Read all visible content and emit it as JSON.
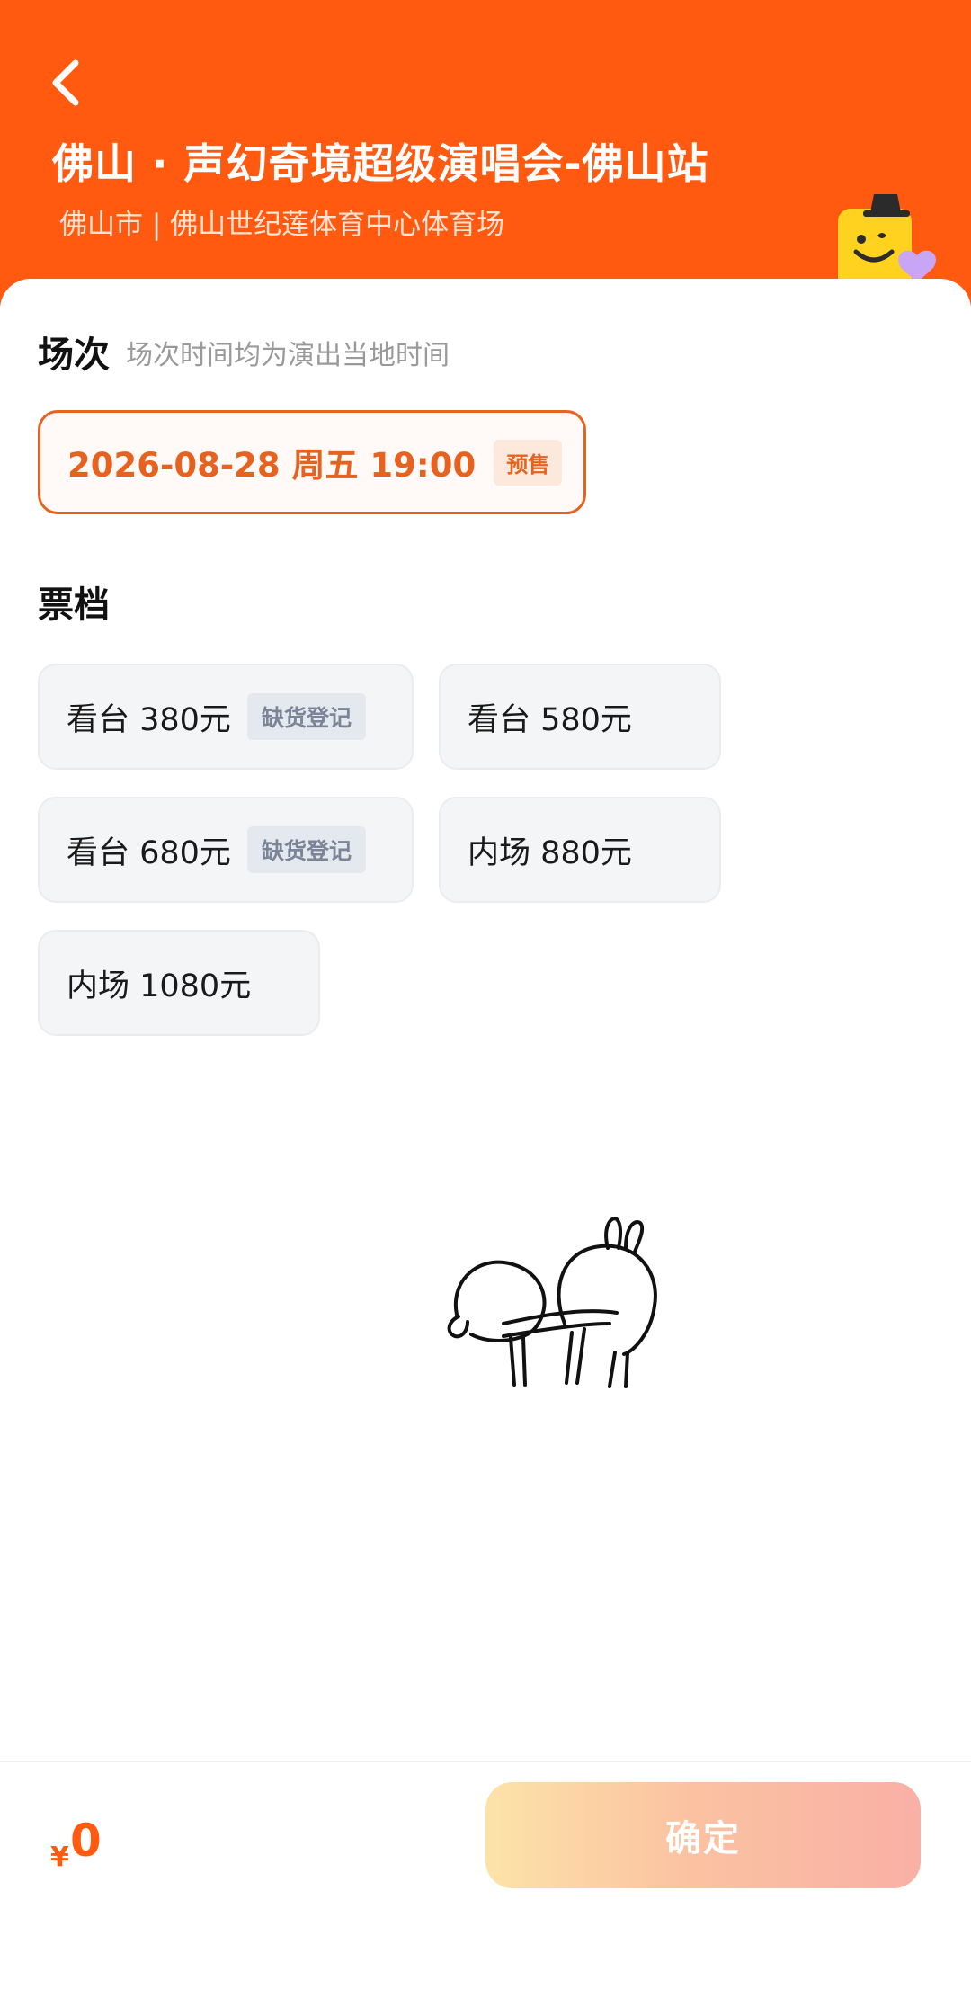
{
  "header": {
    "back_icon": "chevron-left-icon",
    "title": "佛山 · 声幻奇境超级演唱会-佛山站",
    "venue": "佛山市 | 佛山世纪莲体育中心体育场",
    "mascot_icon": "smiley-mascot-icon"
  },
  "session": {
    "title": "场次",
    "hint": "场次时间均为演出当地时间",
    "option": {
      "datetime": "2026-08-28  周五 19:00",
      "tag": "预售",
      "selected": true
    }
  },
  "tickets": {
    "title": "票档",
    "options": [
      {
        "label": "看台 380元",
        "tag": "缺货登记"
      },
      {
        "label": "看台 580元",
        "tag": ""
      },
      {
        "label": "看台 680元",
        "tag": "缺货登记"
      },
      {
        "label": "内场 880元",
        "tag": ""
      },
      {
        "label": "内场 1080元",
        "tag": ""
      }
    ]
  },
  "illustration": {
    "icon": "rabbit-doodle-icon"
  },
  "footer": {
    "currency": "¥",
    "total": "0",
    "confirm_label": "确定"
  },
  "colors": {
    "brand_orange": "#ff5a0f",
    "accent_orange": "#e8621f",
    "waitlist_tag_bg": "#e4e8ef",
    "chip_bg": "#f4f5f7"
  }
}
